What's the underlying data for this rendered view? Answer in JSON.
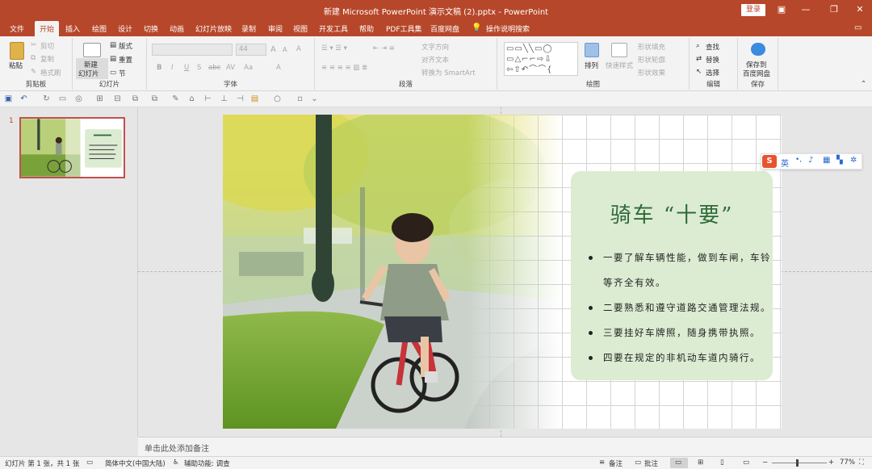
{
  "window": {
    "title": "新建 Microsoft PowerPoint 演示文稿 (2).pptx  -  PowerPoint",
    "login": "登录"
  },
  "tabs": [
    "文件",
    "开始",
    "插入",
    "绘图",
    "设计",
    "切换",
    "动画",
    "幻灯片放映",
    "录制",
    "审阅",
    "视图",
    "开发工具",
    "帮助",
    "PDF工具集",
    "百度网盘"
  ],
  "tell_me": "操作说明搜索",
  "ribbon": {
    "clipboard": {
      "label": "剪贴板",
      "paste": "粘贴",
      "cut": "剪切",
      "copy": "复制",
      "format_painter": "格式刷"
    },
    "slides": {
      "label": "幻灯片",
      "new_slide_1": "新建",
      "new_slide_2": "幻灯片",
      "layout": "版式",
      "reset": "重置",
      "section": "节"
    },
    "font": {
      "label": "字体",
      "size": "44",
      "bold": "B",
      "italic": "I",
      "underline": "U",
      "shadow": "S",
      "strike": "abc",
      "spacing": "AV",
      "case": "Aa",
      "grow": "A",
      "shrink": "A",
      "clear": "A",
      "color": "A"
    },
    "paragraph": {
      "label": "段落",
      "text_direction": "文字方向",
      "align_text": "对齐文本",
      "smartart": "转换为 SmartArt"
    },
    "drawing": {
      "label": "绘图",
      "arrange": "排列",
      "quick_styles": "快速样式",
      "shape_fill": "形状填充",
      "shape_outline": "形状轮廓",
      "shape_effects": "形状效果"
    },
    "editing": {
      "label": "编辑",
      "find": "查找",
      "replace": "替换",
      "select": "选择"
    },
    "save": {
      "label": "保存",
      "save_to_1": "保存到",
      "save_to_2": "百度网盘"
    }
  },
  "slide_panel": {
    "number": "1"
  },
  "slide": {
    "title": "骑车 “十要”",
    "bullets": [
      "一要了解车辆性能，做到车闸，车铃等齐全有效。",
      "二要熟悉和遵守道路交通管理法规。",
      "三要挂好车牌照，随身携带执照。",
      "四要在规定的非机动车道内骑行。"
    ]
  },
  "ime": {
    "mode": "英"
  },
  "notes": {
    "placeholder": "单击此处添加备注"
  },
  "status": {
    "slide_count": "幻灯片 第 1 张，共 1 张",
    "language": "简体中文(中国大陆)",
    "accessibility": "辅助功能: 调查",
    "notes_btn": "备注",
    "comments_btn": "批注",
    "zoom": "77%"
  },
  "colors": {
    "accent": "#b7472a",
    "title_green": "#2f6a3a",
    "box_green": "#dcecd2"
  }
}
